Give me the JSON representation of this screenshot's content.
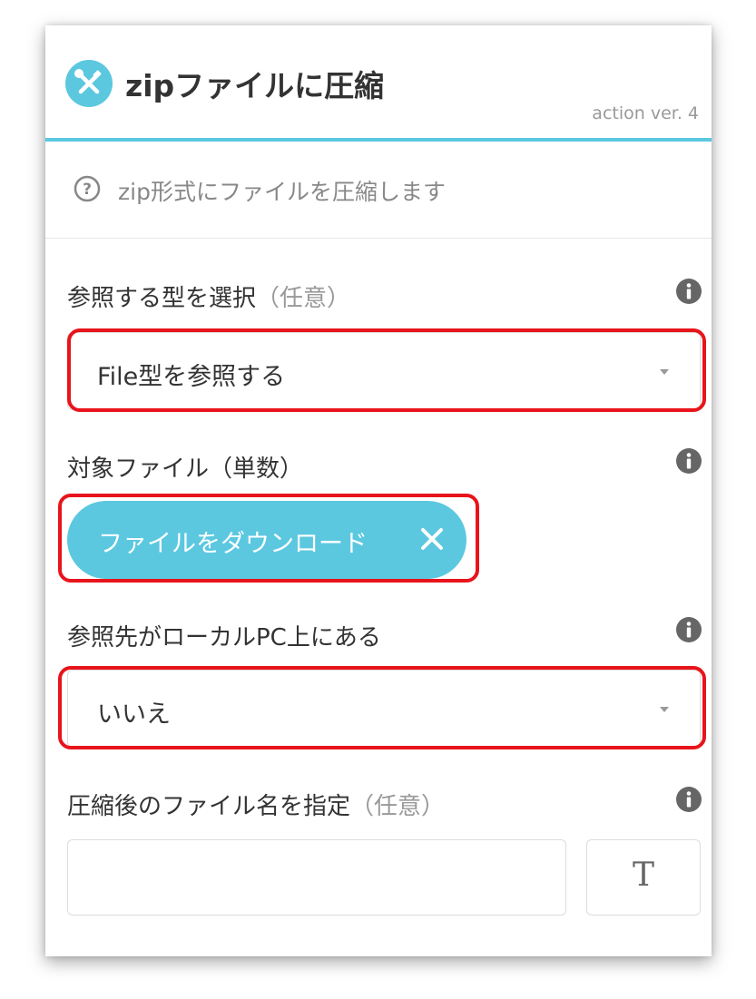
{
  "header": {
    "title": "zipファイルに圧縮",
    "version": "action ver. 4",
    "logo_icon": "tools-icon",
    "accent_color": "#5bc8e0"
  },
  "description": {
    "icon": "question-circle-icon",
    "text": "zip形式にファイルを圧縮します"
  },
  "fields": {
    "reference_type": {
      "label": "参照する型を選択",
      "optional": "（任意）",
      "selected": "File型を参照する"
    },
    "target_file": {
      "label": "対象ファイル（単数）",
      "chip_label": "ファイルをダウンロード"
    },
    "local_pc": {
      "label": "参照先がローカルPC上にある",
      "selected": "いいえ"
    },
    "output_name": {
      "label": "圧縮後のファイル名を指定",
      "optional": "（任意）",
      "value": "",
      "text_button": "T"
    }
  },
  "highlight_color": "#e8141c"
}
